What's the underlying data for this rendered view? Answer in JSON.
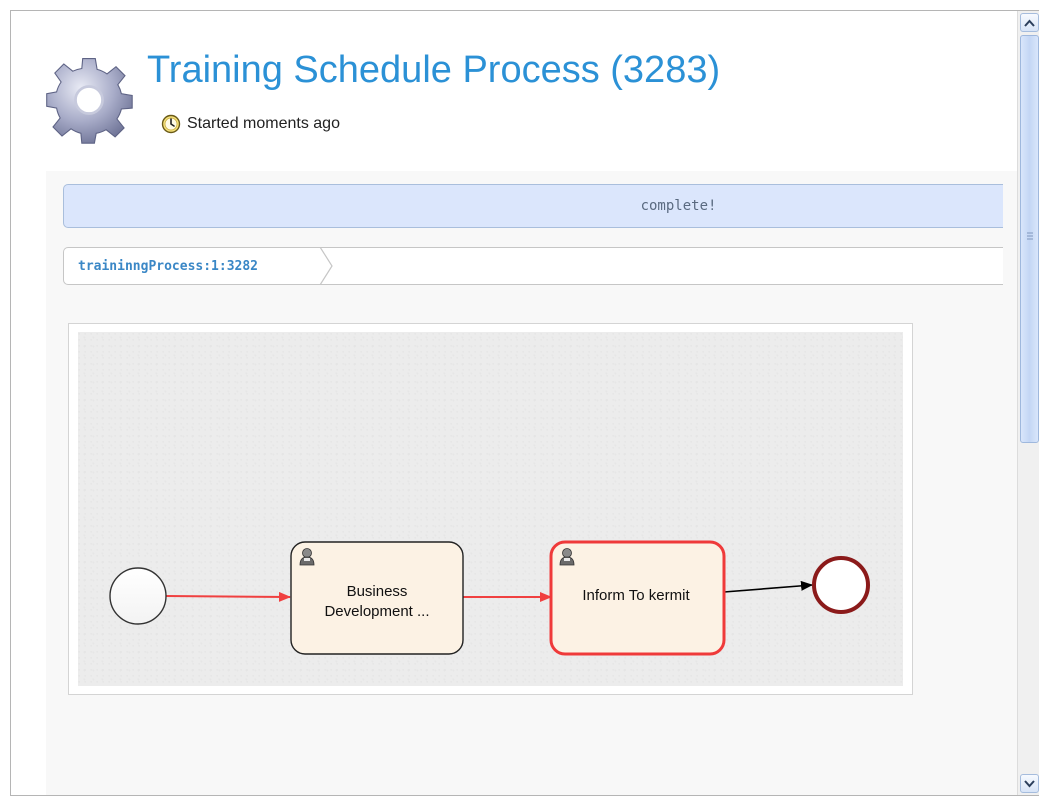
{
  "header": {
    "title": "Training Schedule Process (3283)",
    "started": "Started moments ago",
    "icon": "gear-icon"
  },
  "status": {
    "text": "complete!",
    "color": "#dbe6fc"
  },
  "breadcrumb": {
    "items": [
      "traininngProcess:1:3282"
    ]
  },
  "diagram": {
    "nodes": [
      {
        "id": "start",
        "type": "start-event"
      },
      {
        "id": "task1",
        "type": "user-task",
        "label_line1": "Business",
        "label_line2": "Development ...",
        "state": "completed"
      },
      {
        "id": "task2",
        "type": "user-task",
        "label_line1": "Inform To kermit",
        "state": "active"
      },
      {
        "id": "end",
        "type": "end-event"
      }
    ],
    "flows": [
      {
        "from": "start",
        "to": "task1",
        "state": "taken"
      },
      {
        "from": "task1",
        "to": "task2",
        "state": "taken"
      },
      {
        "from": "task2",
        "to": "end",
        "state": "pending"
      }
    ],
    "colors": {
      "taken": "#f04040",
      "pending": "#000000",
      "task_fill": "#fcf2e4",
      "end_stroke": "#8b1a1a"
    }
  },
  "scrollbar": {
    "up": "scroll-up-arrow",
    "down": "scroll-down-arrow"
  }
}
